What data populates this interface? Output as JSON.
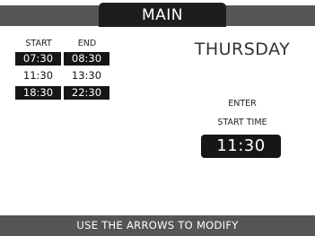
{
  "header": {
    "title": "MAIN"
  },
  "schedule": {
    "start_label": "START",
    "end_label": "END",
    "rows": [
      {
        "start": "07:30",
        "end": "08:30",
        "highlighted": true
      },
      {
        "start": "11:30",
        "end": "13:30",
        "highlighted": false
      },
      {
        "start": "18:30",
        "end": "22:30",
        "highlighted": true
      }
    ]
  },
  "day": "THURSDAY",
  "prompt": {
    "line1": "ENTER",
    "line2": "START TIME"
  },
  "time_value": "11:30",
  "footer": {
    "hint": "USE THE ARROWS TO MODIFY"
  },
  "colors": {
    "dark": "#161616",
    "bar": "#555555",
    "background": "#ffffff"
  }
}
